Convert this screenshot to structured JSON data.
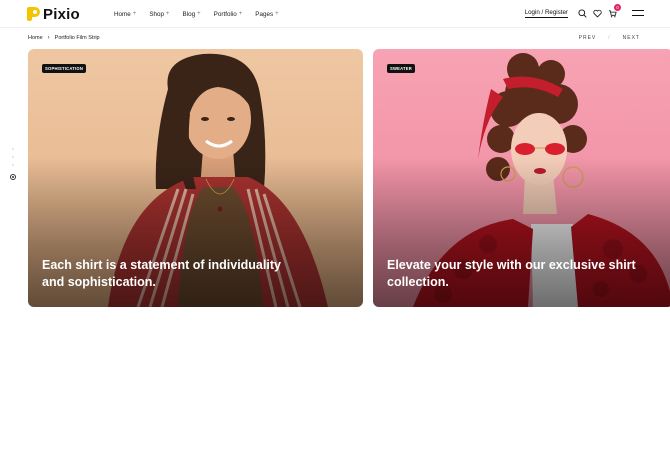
{
  "brand": {
    "name": "Pixio",
    "accent": "#f5c400"
  },
  "nav": {
    "items": [
      {
        "label": "Home",
        "suffix": "+"
      },
      {
        "label": "Shop",
        "suffix": "+"
      },
      {
        "label": "Blog",
        "suffix": "+"
      },
      {
        "label": "Portfolio",
        "suffix": "+"
      },
      {
        "label": "Pages",
        "suffix": "+"
      }
    ]
  },
  "header": {
    "login_label": "Login / Register",
    "cart_count": "0",
    "icons": [
      "search-icon",
      "heart-icon",
      "cart-icon",
      "menu-icon"
    ]
  },
  "breadcrumb": {
    "home": "Home",
    "current": "Portfolio Film Strip"
  },
  "pager": {
    "prev": "PREV",
    "divider": "/",
    "next": "NEXT"
  },
  "cards": [
    {
      "tag": "SOPHISTICATION",
      "caption": "Each shirt is a statement of individuality and sophistication."
    },
    {
      "tag": "SWEATER",
      "caption": "Elevate your style with our exclusive shirt collection."
    }
  ]
}
